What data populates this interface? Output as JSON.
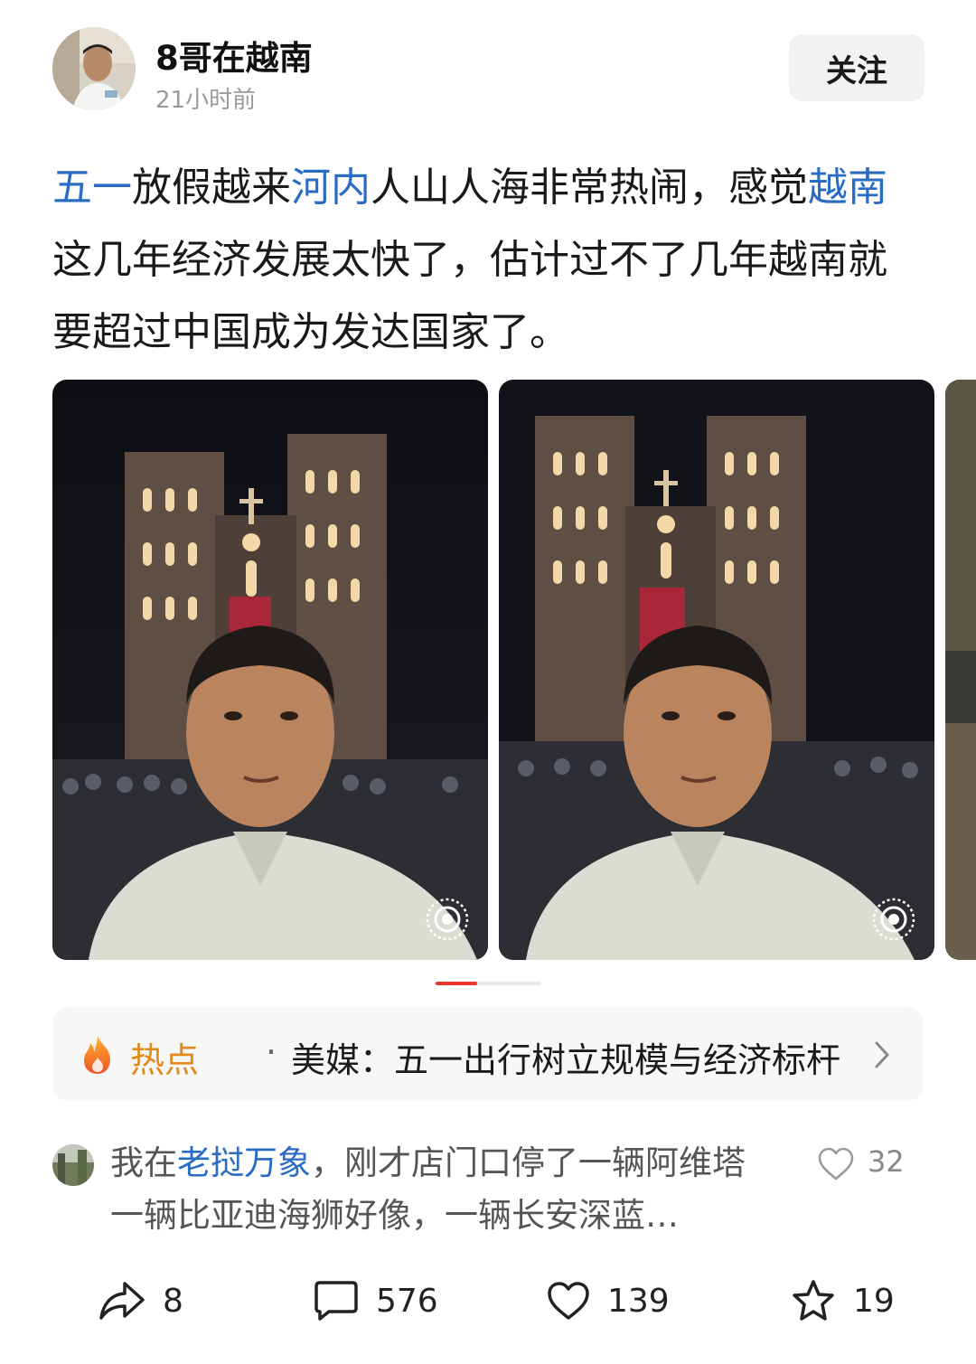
{
  "post": {
    "author": "8哥在越南",
    "time": "21小时前",
    "follow_label": "关注",
    "text_segments": [
      {
        "text": "五一",
        "tag": true
      },
      {
        "text": "放假越来",
        "tag": false
      },
      {
        "text": "河内",
        "tag": true
      },
      {
        "text": "人山人海非常热闹，感觉",
        "tag": false
      },
      {
        "text": "越南",
        "tag": true
      },
      {
        "text": "这几年经济发展太快了，估计过不了几年越南就要超过中国成为发达国家了。",
        "tag": false
      }
    ]
  },
  "gallery": {
    "photos": [
      {
        "icon": "live-photo-icon"
      },
      {
        "icon": "live-photo-icon"
      },
      {
        "icon": "none"
      }
    ],
    "active_index": 0,
    "active_color": "#e8372e"
  },
  "hot": {
    "label": "热点",
    "separator": "·",
    "title": "美媒：五一出行树立规模与经济标杆",
    "icon": "fire-icon",
    "label_color": "#e08a1c"
  },
  "top_comment": {
    "prefix": "我在",
    "tag": "老挝万象",
    "body": "，刚才店门口停了一辆阿维塔 一辆比亚迪海狮好像，一辆长安深蓝…",
    "likes": "32"
  },
  "actions": {
    "share": "8",
    "comments": "576",
    "likes": "139",
    "favorites": "19"
  },
  "colors": {
    "tag_blue": "#2a6cc3",
    "muted_gray": "#9a9a9a"
  }
}
